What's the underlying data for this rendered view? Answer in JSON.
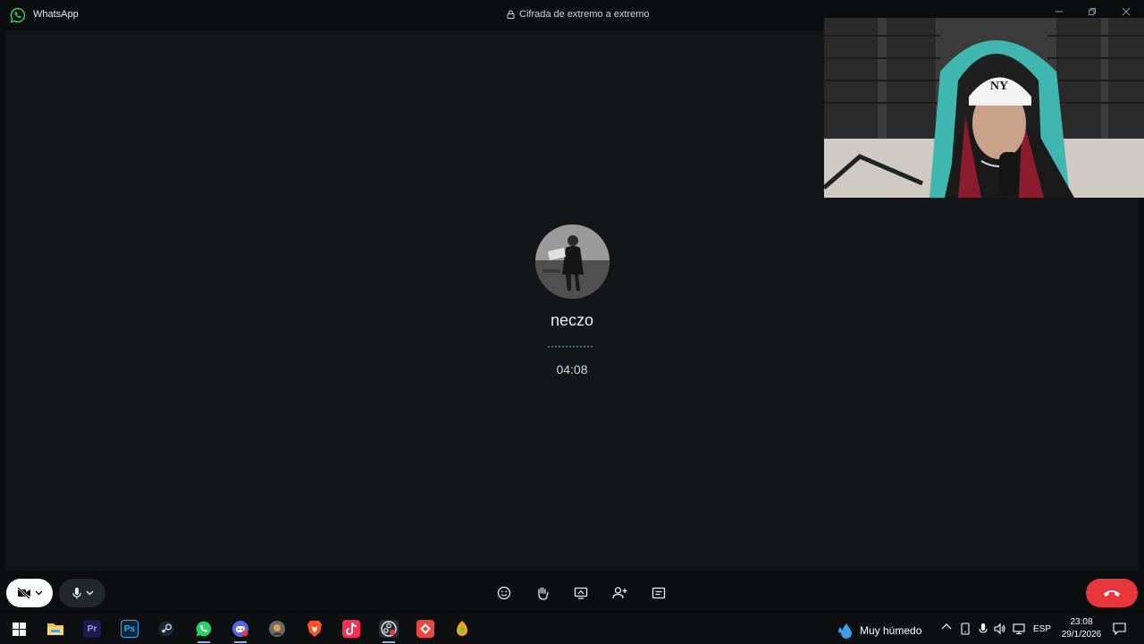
{
  "window": {
    "app_name": "WhatsApp",
    "encryption_label": "Cifrada de extremo a extremo"
  },
  "call": {
    "contact_name": "neczo",
    "duration": "04:08"
  },
  "controls": {
    "items": [
      "camera-off-icon",
      "microphone-icon",
      "emoji-icon",
      "raise-hand-icon",
      "screen-share-icon",
      "add-person-icon",
      "captions-icon",
      "end-call-icon"
    ]
  },
  "taskbar": {
    "apps": [
      "windows-start",
      "file-explorer",
      "premiere-pro",
      "photoshop",
      "steam",
      "whatsapp",
      "discord",
      "app-circle",
      "brave",
      "tiktok",
      "obs",
      "anydesk",
      "fl-studio"
    ],
    "premiere_label": "Pr",
    "photoshop_label": "Ps",
    "weather_text": "Muy húmedo",
    "language": "ESP",
    "time": "23:08",
    "date": "29/1/2026"
  },
  "colors": {
    "accent_green": "#25d366",
    "end_call_red": "#e8363d",
    "call_bg": "#121619"
  }
}
